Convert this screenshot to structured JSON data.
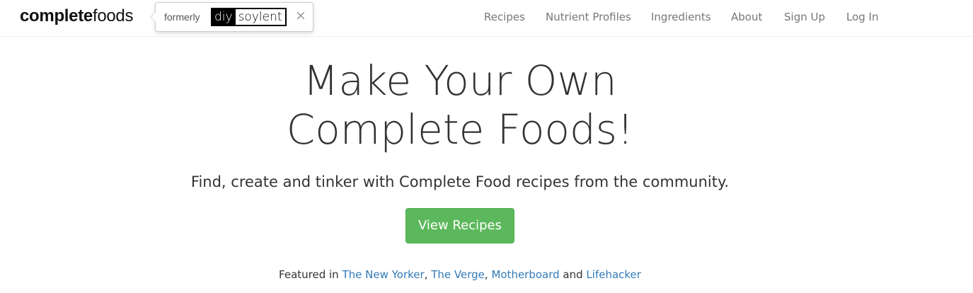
{
  "brand": {
    "part1": "complete",
    "part2": "foods"
  },
  "popover": {
    "formerly_label": "formerly",
    "logo_diy": "diy",
    "logo_soylent": "soylent",
    "close_symbol": "×"
  },
  "nav": {
    "recipes": "Recipes",
    "nutrient_profiles": "Nutrient Profiles",
    "ingredients": "Ingredients",
    "about": "About",
    "sign_up": "Sign Up",
    "log_in": "Log In"
  },
  "hero": {
    "title_line1": "Make Your Own",
    "title_line2": "Complete Foods!",
    "subtitle": "Find, create and tinker with Complete Food recipes from the community.",
    "cta_label": "View Recipes"
  },
  "featured": {
    "prefix": "Featured in ",
    "outlets": [
      "The New Yorker",
      "The Verge",
      "Motherboard",
      "Lifehacker"
    ],
    "sep1": ", ",
    "sep2": ", ",
    "conjunction": " and "
  },
  "colors": {
    "cta_green": "#5cb85c",
    "link_blue": "#337ab7",
    "nav_gray": "#777777"
  }
}
